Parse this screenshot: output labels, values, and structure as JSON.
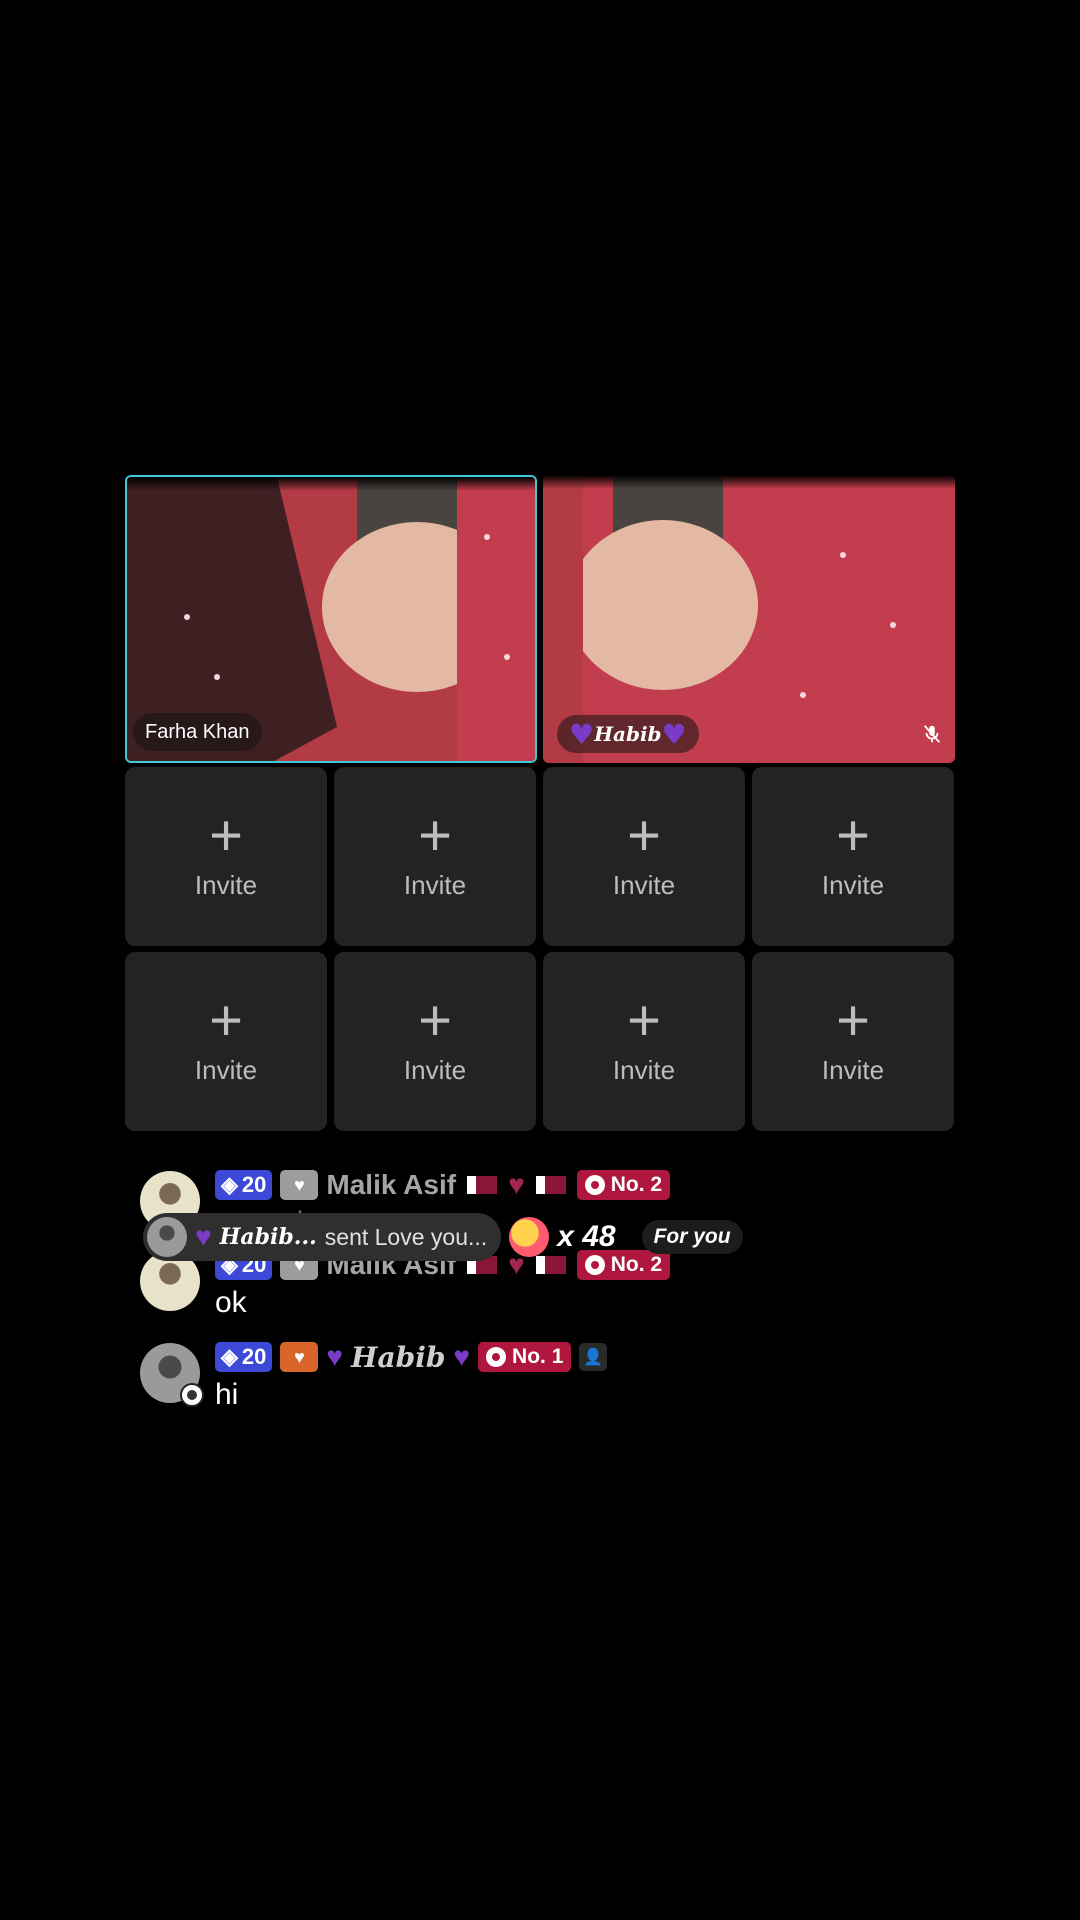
{
  "co_hosts": [
    {
      "name": "Farha Khan",
      "muted": false
    },
    {
      "name": "Habib",
      "muted": true
    }
  ],
  "invite_slots": [
    {
      "icon": "plus-icon",
      "label": "Invite"
    },
    {
      "icon": "plus-icon",
      "label": "Invite"
    },
    {
      "icon": "plus-icon",
      "label": "Invite"
    },
    {
      "icon": "plus-icon",
      "label": "Invite"
    },
    {
      "icon": "plus-icon",
      "label": "Invite"
    },
    {
      "icon": "plus-icon",
      "label": "Invite"
    },
    {
      "icon": "plus-icon",
      "label": "Invite"
    },
    {
      "icon": "plus-icon",
      "label": "Invite"
    }
  ],
  "messages": [
    {
      "level": "20",
      "username": "Malik Asif",
      "rank": "No. 2",
      "text": "very nice"
    },
    {
      "level": "20",
      "username": "Malik Asif",
      "rank": "No. 2",
      "text": "ok"
    },
    {
      "level": "20",
      "username": "Habib",
      "rank": "No. 1",
      "text": "hi"
    }
  ],
  "gift_banner": {
    "sender": "Habib...",
    "text": "sent Love you...",
    "count": "x 48",
    "tag": "For you"
  },
  "colors": {
    "accent_border": "#3fc8d6",
    "level_badge": "#3b49d6",
    "rank_badge": "#b0173f"
  }
}
